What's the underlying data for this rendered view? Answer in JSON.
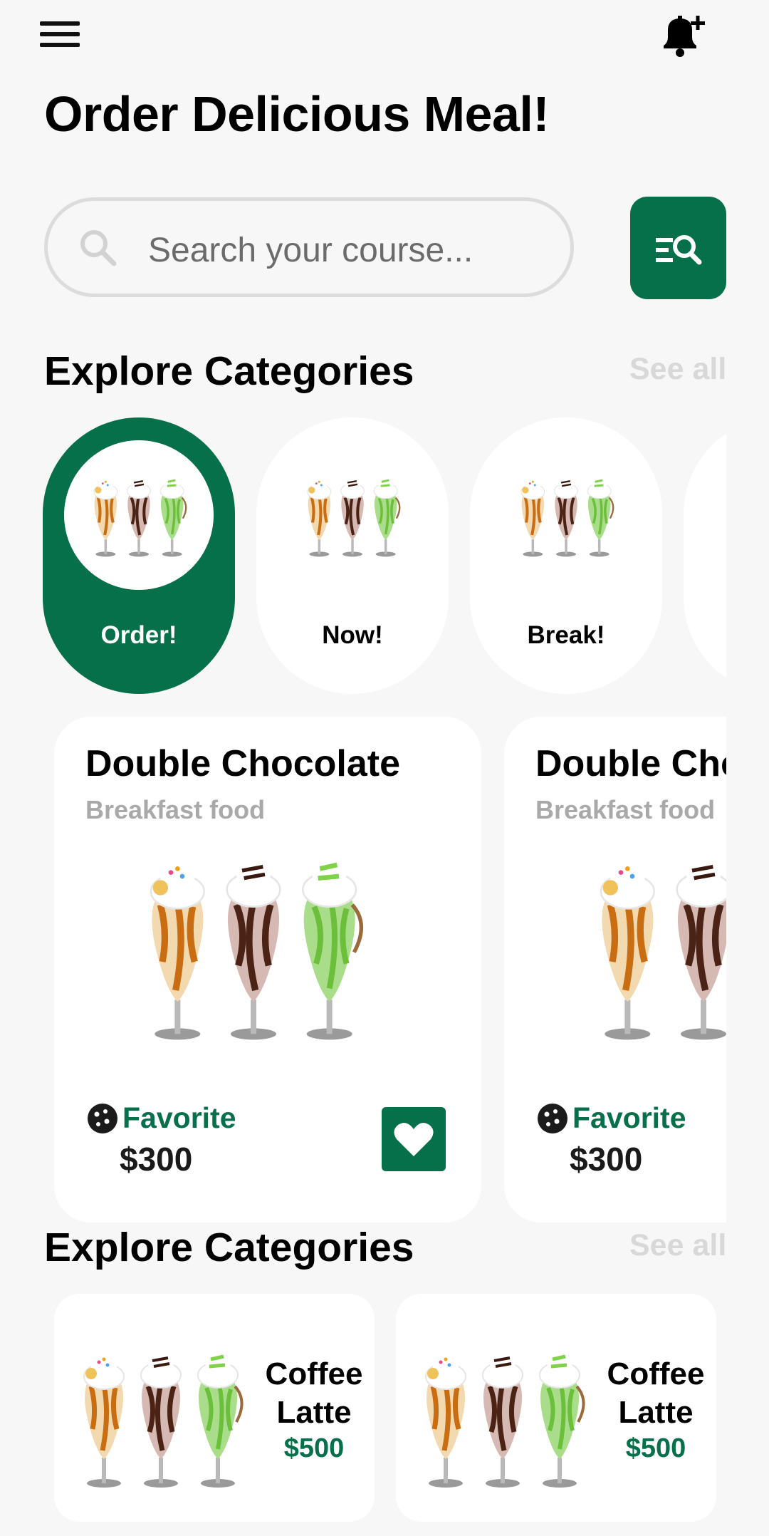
{
  "header": {
    "menu_icon": "hamburger-menu-icon",
    "notification_icon": "bell-plus-icon",
    "title": "Order Delicious Meal!"
  },
  "search": {
    "placeholder": "Search your course...",
    "search_icon": "search-icon",
    "filter_icon": "filter-search-icon"
  },
  "categories_section": {
    "title": "Explore Categories",
    "see_all": "See all",
    "items": [
      {
        "label": "Order!",
        "active": true
      },
      {
        "label": "Now!",
        "active": false
      },
      {
        "label": "Break!",
        "active": false
      }
    ]
  },
  "food_cards": [
    {
      "title": "Double Chocolate",
      "subtitle": "Breakfast food",
      "fav_label": "Favorite",
      "price": "$300"
    },
    {
      "title": "Double Chocolate",
      "subtitle": "Breakfast food",
      "fav_label": "Favorite",
      "price": "$300"
    }
  ],
  "bottom_section": {
    "title": "Explore Categories",
    "see_all": "See all",
    "items": [
      {
        "name": "Coffee Latte",
        "price": "$500"
      },
      {
        "name": "Coffee Latte",
        "price": "$500"
      }
    ]
  },
  "colors": {
    "accent": "#06704a",
    "background": "#f7f7f7",
    "card": "#ffffff",
    "muted_text": "#a9a9a9"
  }
}
